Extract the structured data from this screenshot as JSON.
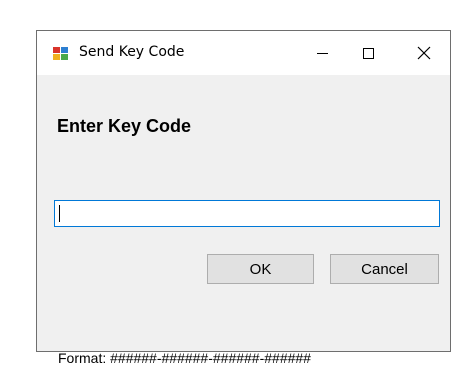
{
  "window": {
    "title": "Send Key Code",
    "icon": "app-window-icon",
    "controls": {
      "minimize": "minimize-icon",
      "maximize": "maximize-icon",
      "close": "close-icon"
    }
  },
  "form": {
    "heading": "Enter Key Code",
    "key_input_value": "",
    "ok_label": "OK",
    "cancel_label": "Cancel",
    "format_hint": "Format: ######-######-######-######"
  },
  "colors": {
    "dialog_background": "#f0f0f0",
    "titlebar_background": "#ffffff",
    "input_focus_border": "#0078d7",
    "button_face": "#e1e1e1"
  }
}
